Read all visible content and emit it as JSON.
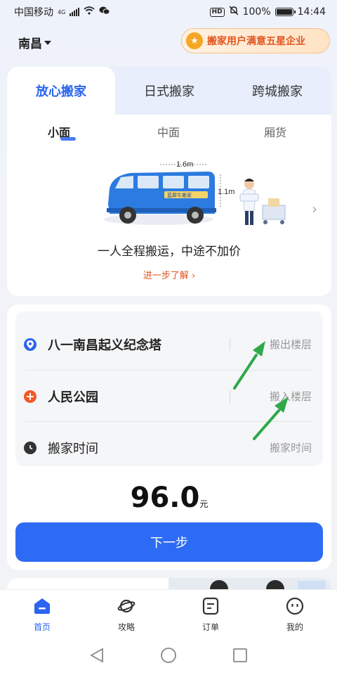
{
  "status": {
    "carrier": "中国移动",
    "network": "4G",
    "battery": "100%",
    "time": "14:44"
  },
  "header": {
    "city": "南昌",
    "badge": "搬家用户满意五星企业"
  },
  "main_tabs": [
    {
      "label": "放心搬家"
    },
    {
      "label": "日式搬家"
    },
    {
      "label": "跨城搬家"
    }
  ],
  "vehicle_tabs": [
    {
      "label": "小面"
    },
    {
      "label": "中面"
    },
    {
      "label": "厢货"
    }
  ],
  "vehicle": {
    "length": "1.6m",
    "height": "1.1m",
    "body_text": "蓝犀牛搬家"
  },
  "slogan": "一人全程搬运，中途不加价",
  "learn_more": "进一步了解 ›",
  "form": {
    "from": {
      "address": "八一南昌起义纪念塔",
      "floor_placeholder": "搬出楼层"
    },
    "to": {
      "address": "人民公园",
      "floor_placeholder": "搬入楼层"
    },
    "time": {
      "label": "搬家时间",
      "placeholder": "搬家时间"
    }
  },
  "price": {
    "amount": "96.0",
    "unit": "元"
  },
  "next_button": "下一步",
  "bottom_nav": [
    {
      "label": "首页"
    },
    {
      "label": "攻略"
    },
    {
      "label": "订单"
    },
    {
      "label": "我的"
    }
  ],
  "colors": {
    "accent": "#2a64f0",
    "orange": "#e2541e",
    "annotation_arrow": "#2fa84a"
  }
}
